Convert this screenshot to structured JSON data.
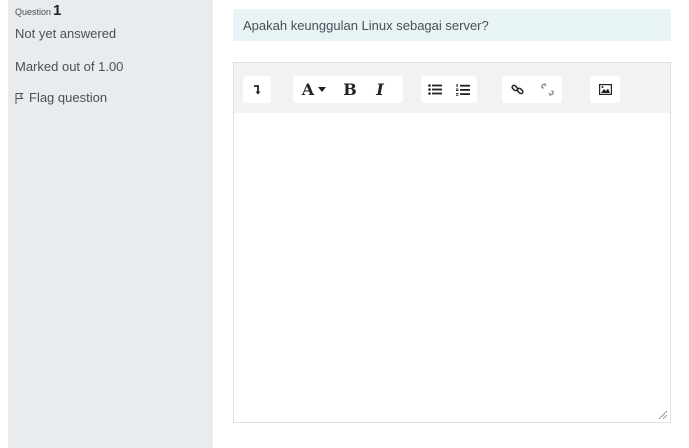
{
  "info": {
    "question_label": "Question",
    "question_number": "1",
    "state": "Not yet answered",
    "grade": "Marked out of 1.00",
    "flag_label": "Flag question"
  },
  "question": {
    "text": "Apakah keunggulan Linux sebagai server?"
  },
  "editor": {
    "font_button_label": "A",
    "bold_label": "B",
    "italic_label": "I",
    "content": ""
  },
  "colors": {
    "info_bg": "#e9ecef",
    "qtext_bg": "#e7f3f5",
    "toolbar_bg": "#f2f2f2"
  }
}
